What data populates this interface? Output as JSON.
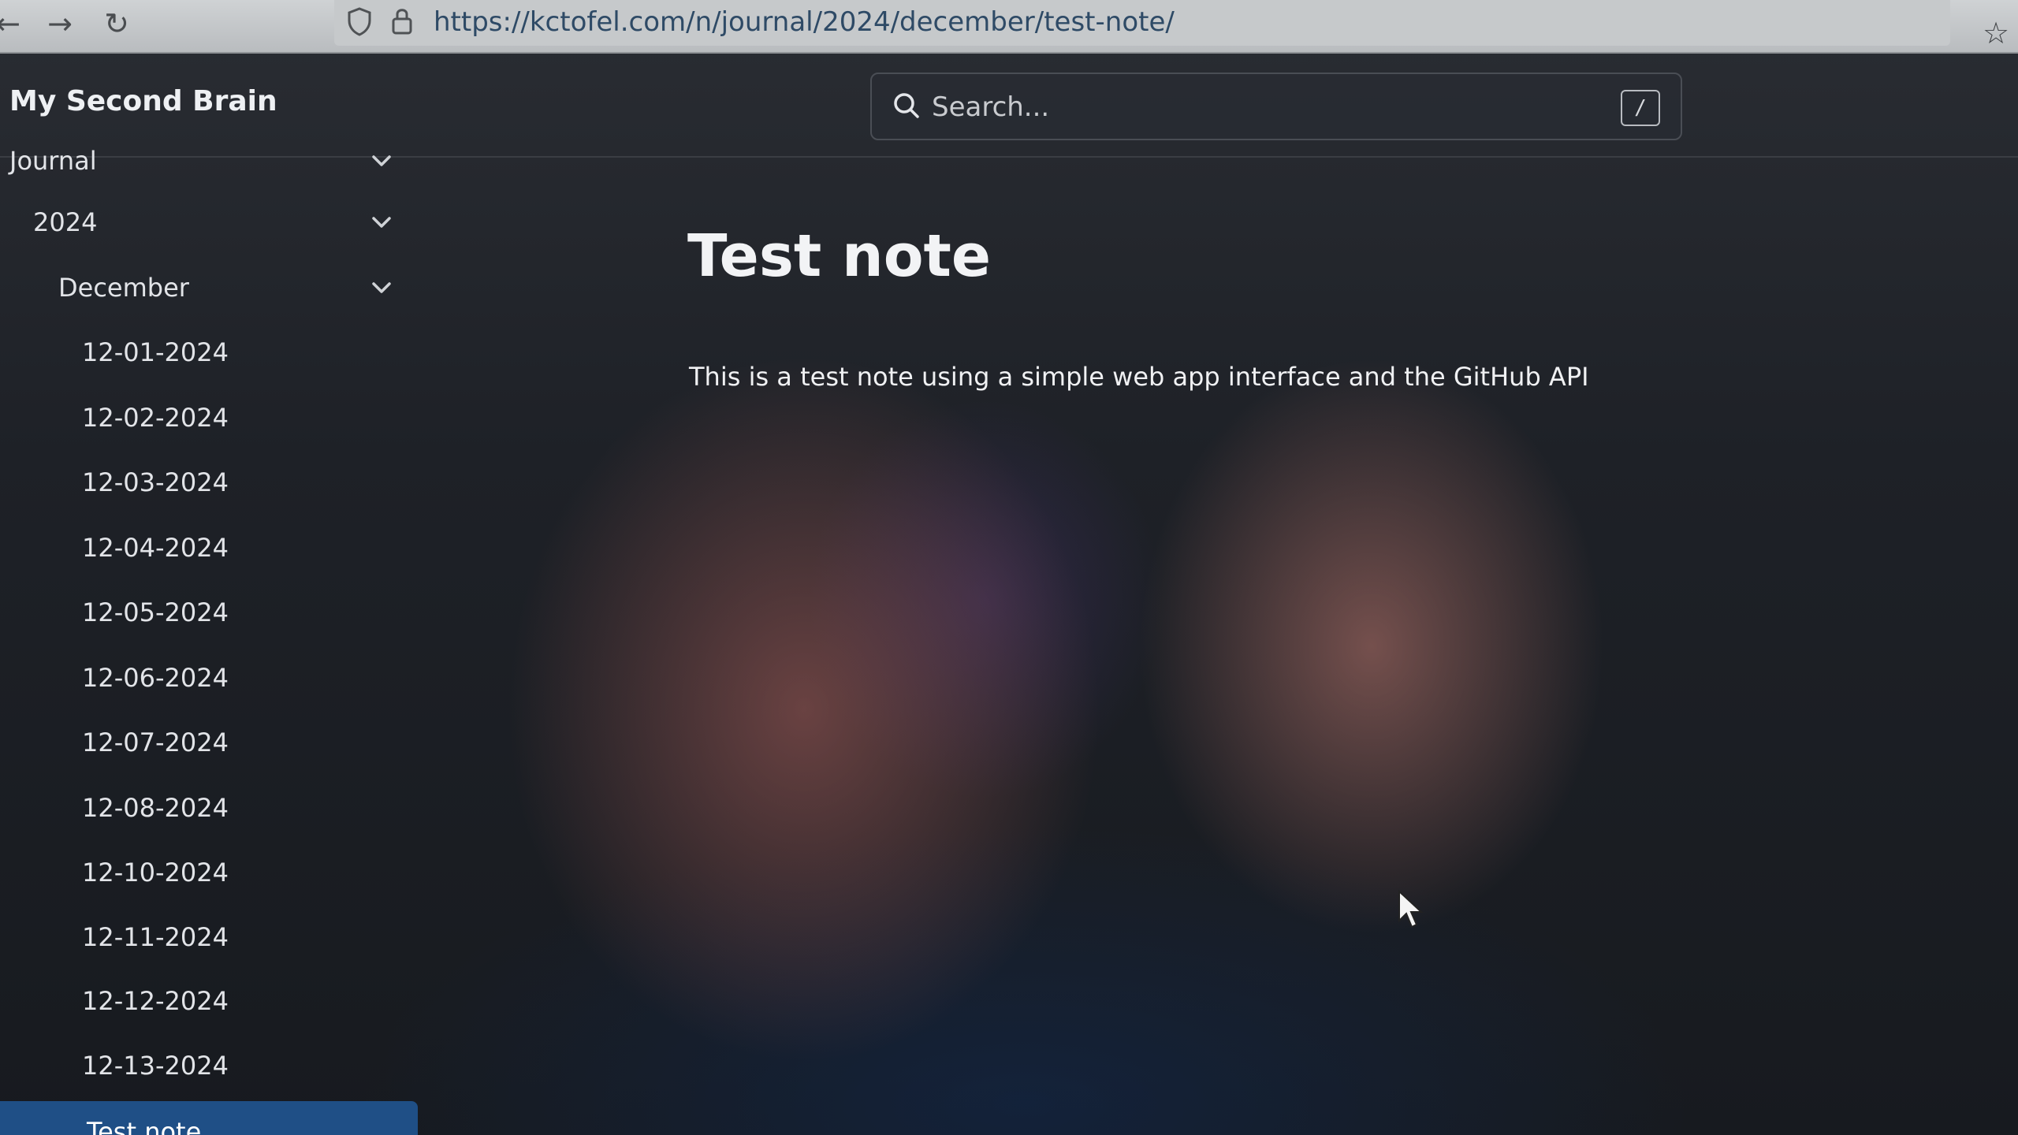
{
  "browser": {
    "url": "https://kctofel.com/n/journal/2024/december/test-note/",
    "icons": {
      "back": "back-arrow-icon",
      "forward": "forward-arrow-icon",
      "reload": "reload-icon",
      "shield": "shield-icon",
      "lock": "lock-icon",
      "bookmark": "star-icon"
    }
  },
  "header": {
    "brand": "My Second Brain",
    "search": {
      "placeholder": "Search...",
      "shortcut": "/"
    }
  },
  "sidebar": {
    "sections": [
      {
        "label": "Journal",
        "expanded": true
      },
      {
        "label": "2024",
        "expanded": true
      },
      {
        "label": "December",
        "expanded": true
      }
    ],
    "items": [
      {
        "label": "12-01-2024"
      },
      {
        "label": "12-02-2024"
      },
      {
        "label": "12-03-2024"
      },
      {
        "label": "12-04-2024"
      },
      {
        "label": "12-05-2024"
      },
      {
        "label": "12-06-2024"
      },
      {
        "label": "12-07-2024"
      },
      {
        "label": "12-08-2024"
      },
      {
        "label": "12-10-2024"
      },
      {
        "label": "12-11-2024"
      },
      {
        "label": "12-12-2024"
      },
      {
        "label": "12-13-2024"
      }
    ],
    "active_item": {
      "label": "Test note"
    }
  },
  "main": {
    "title": "Test note",
    "body": "This is a test note using a simple web app interface and the GitHub API"
  },
  "colors": {
    "accent": "#1f4f86",
    "background": "#1b1d22",
    "text": "#e6e6e6"
  }
}
